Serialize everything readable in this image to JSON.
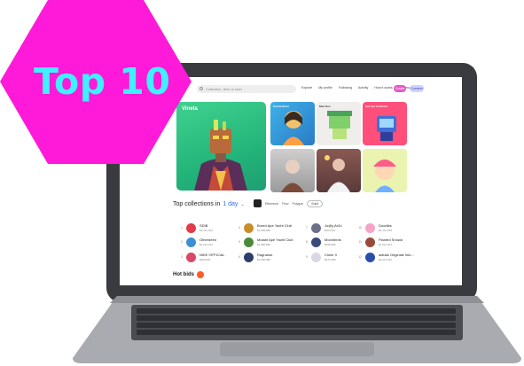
{
  "badge": {
    "text": "Top 10"
  },
  "topbar": {
    "search_placeholder": "Collection, item or user",
    "nav": [
      "Explore",
      "My profile",
      "Following",
      "Activity",
      "How it works",
      "Community"
    ],
    "create": "Create",
    "connect": "Connect"
  },
  "hero": {
    "label": "Vineta"
  },
  "tiles": [
    {
      "label": "Karina Rumi"
    },
    {
      "label": "Mad Box"
    },
    {
      "label": "Get free Collectid"
    },
    {
      "label": ""
    },
    {
      "label": ""
    },
    {
      "label": ""
    }
  ],
  "collections": {
    "title_prefix": "Top collections in",
    "period": "1 day",
    "chips": [
      "Ethereum",
      "Flow",
      "Polygon"
    ],
    "selected": "Solid",
    "rows": [
      {
        "rank": "1",
        "name": "SDIB",
        "sub": "$1,412,004"
      },
      {
        "rank": "2",
        "name": "Otherdeed",
        "sub": "$1,014,201"
      },
      {
        "rank": "3",
        "name": "NIKE OFFICIAL",
        "sub": "$999,081"
      },
      {
        "rank": "4",
        "name": "Bored Ape Yacht Club",
        "sub": "$1,089,885"
      },
      {
        "rank": "5",
        "name": "Mutant Ape Yacht Club",
        "sub": "$1,080,885"
      },
      {
        "rank": "6",
        "name": "Ragnarok",
        "sub": "$1,080,885"
      },
      {
        "rank": "7",
        "name": "Jo@y.Ar2ri",
        "sub": "$404,521"
      },
      {
        "rank": "8",
        "name": "Moonbirds",
        "sub": "$399,985"
      },
      {
        "rank": "9",
        "name": "Clone X",
        "sub": "$375,488"
      },
      {
        "rank": "10",
        "name": "Doodles",
        "sub": "$1,314,025"
      },
      {
        "rank": "11",
        "name": "Planted Snowa",
        "sub": "$1,014,024"
      },
      {
        "rank": "12",
        "name": "adidas Originals Into...",
        "sub": "$1,014,024"
      }
    ]
  },
  "hot_bids": {
    "title": "Hot bids"
  }
}
